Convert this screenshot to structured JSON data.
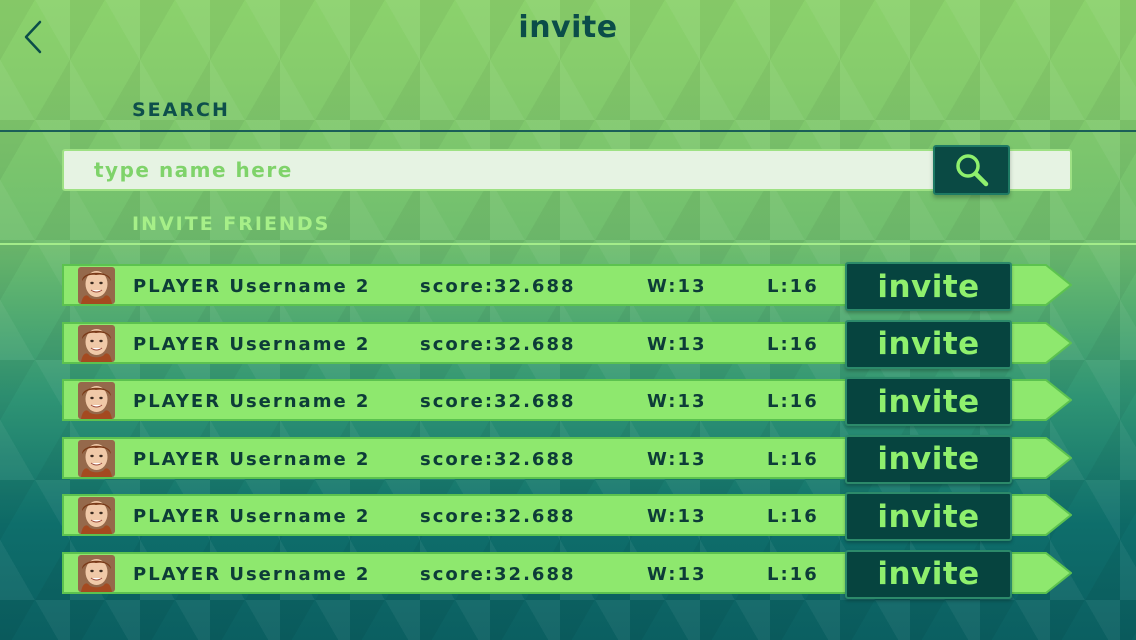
{
  "header": {
    "title": "invite"
  },
  "search": {
    "label": "SEARCH",
    "placeholder": "type name here",
    "value": ""
  },
  "friends": {
    "label": "INVITE FRIENDS",
    "items": [
      {
        "name": "PLAYER Username 2",
        "score": "score:32.688",
        "wins": "W:13",
        "losses": "L:16",
        "action": "invite"
      },
      {
        "name": "PLAYER Username 2",
        "score": "score:32.688",
        "wins": "W:13",
        "losses": "L:16",
        "action": "invite"
      },
      {
        "name": "PLAYER Username 2",
        "score": "score:32.688",
        "wins": "W:13",
        "losses": "L:16",
        "action": "invite"
      },
      {
        "name": "PLAYER Username 2",
        "score": "score:32.688",
        "wins": "W:13",
        "losses": "L:16",
        "action": "invite"
      },
      {
        "name": "PLAYER Username 2",
        "score": "score:32.688",
        "wins": "W:13",
        "losses": "L:16",
        "action": "invite"
      },
      {
        "name": "PLAYER Username 2",
        "score": "score:32.688",
        "wins": "W:13",
        "losses": "L:16",
        "action": "invite"
      }
    ]
  },
  "icons": {
    "back": "chevron-left-icon",
    "search": "magnifier-icon",
    "avatar": "avatar-photo"
  },
  "colors": {
    "accent": "#8ff06d",
    "dark": "#06443f",
    "row": "#8ee86e"
  }
}
